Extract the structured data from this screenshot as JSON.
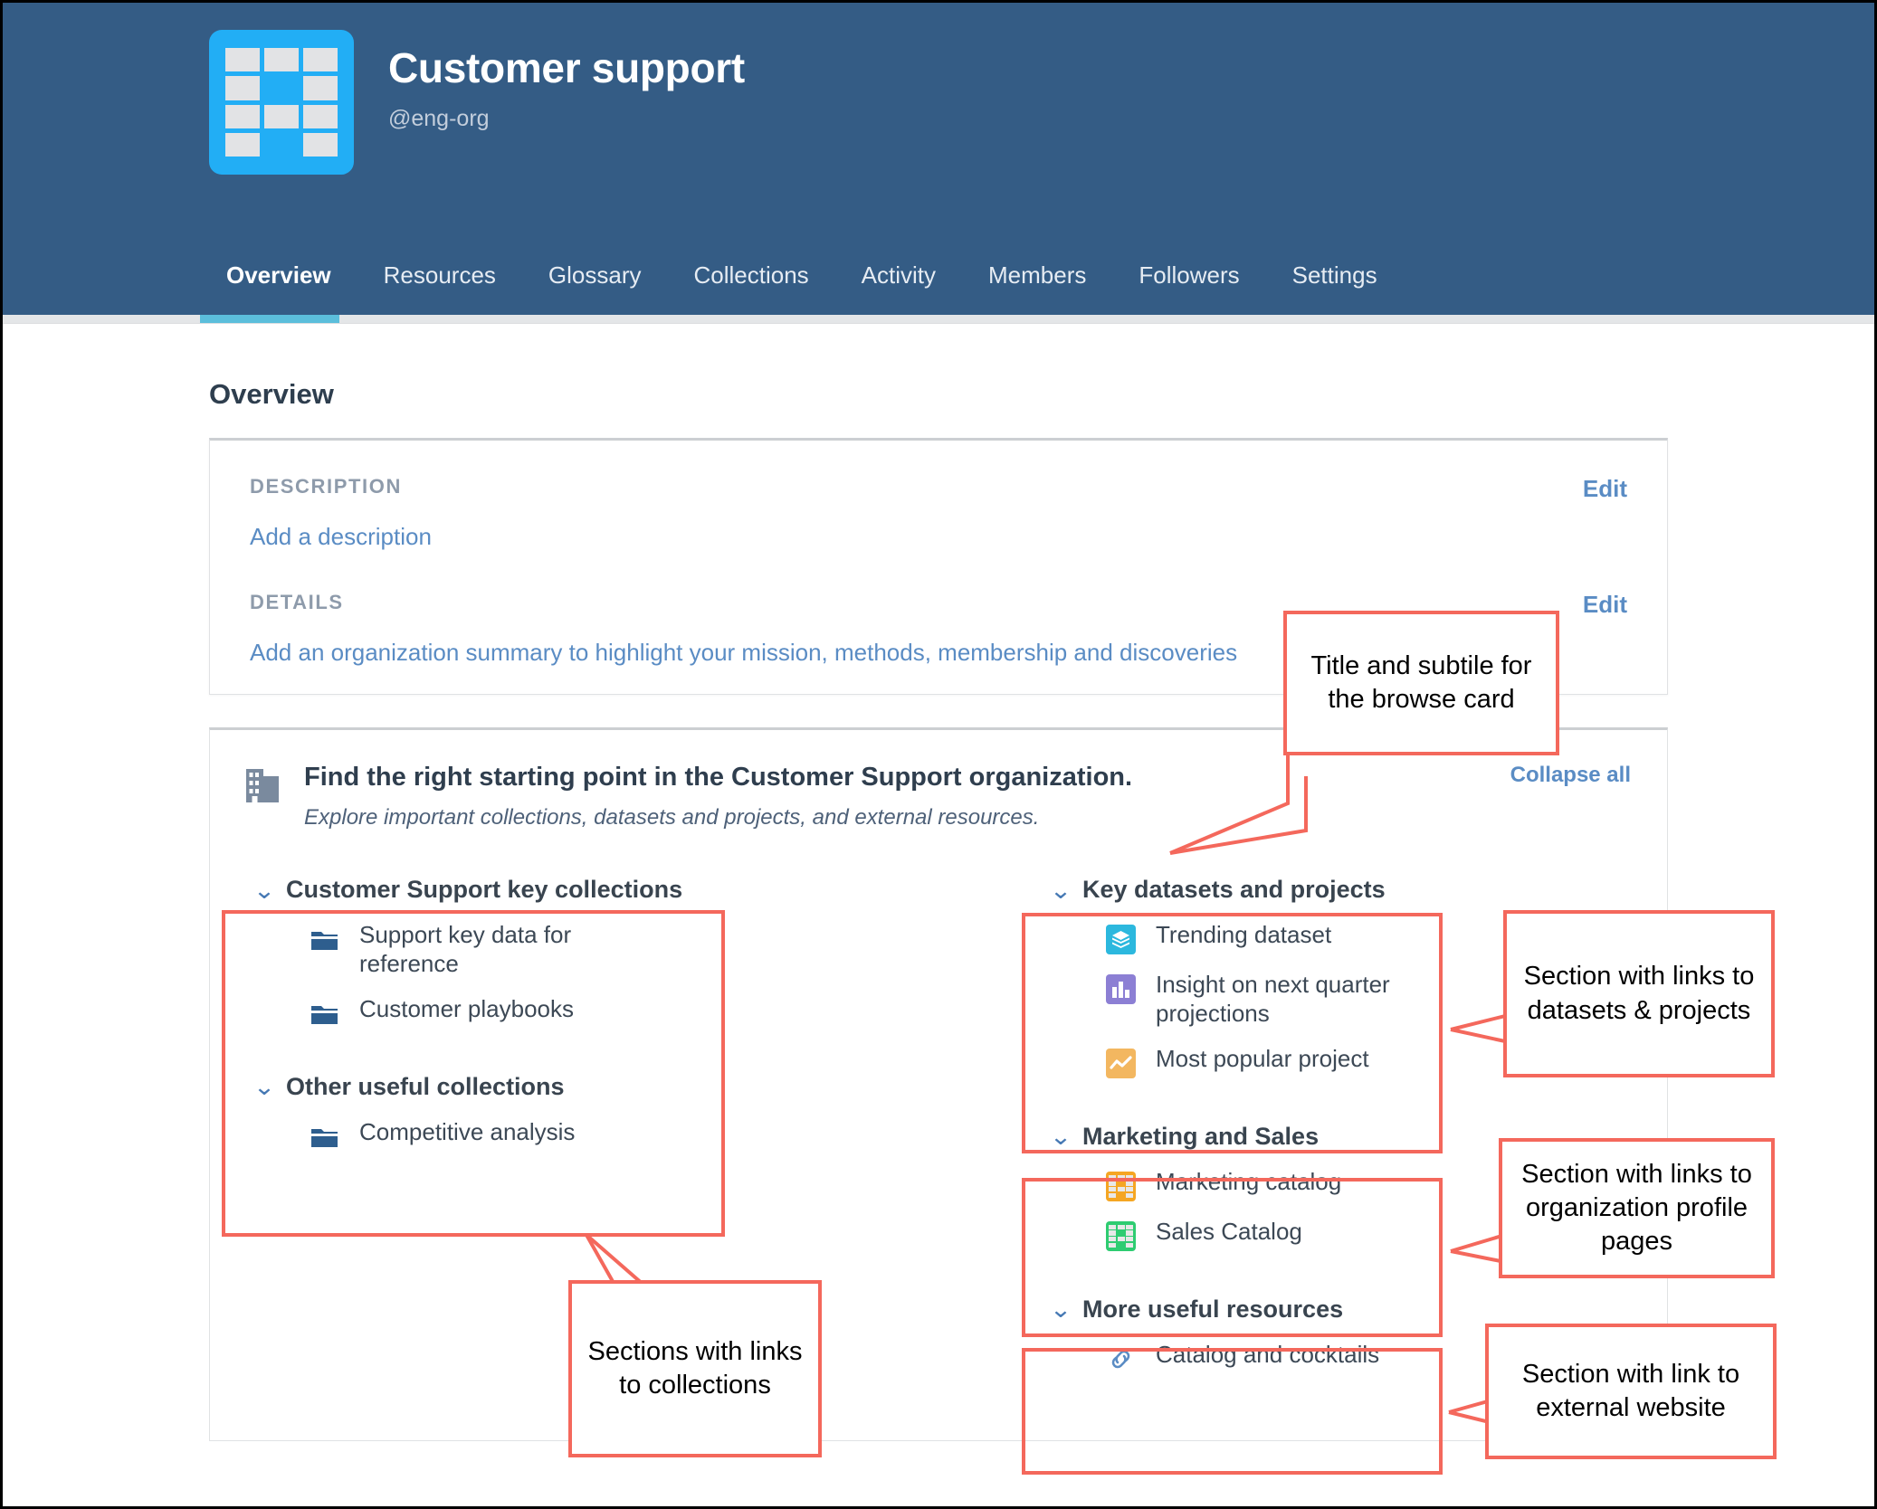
{
  "header": {
    "org_title": "Customer support",
    "org_handle": "@eng-org",
    "logo_icon": "org-grid-logo",
    "tabs": [
      {
        "label": "Overview",
        "active": true
      },
      {
        "label": "Resources",
        "active": false
      },
      {
        "label": "Glossary",
        "active": false
      },
      {
        "label": "Collections",
        "active": false
      },
      {
        "label": "Activity",
        "active": false
      },
      {
        "label": "Members",
        "active": false
      },
      {
        "label": "Followers",
        "active": false
      },
      {
        "label": "Settings",
        "active": false
      }
    ]
  },
  "main": {
    "page_title": "Overview",
    "description": {
      "label": "DESCRIPTION",
      "placeholder_link": "Add a description",
      "edit_label": "Edit"
    },
    "details": {
      "label": "DETAILS",
      "placeholder_link": "Add an organization summary to highlight your mission, methods, membership and discoveries",
      "edit_label": "Edit"
    },
    "browse": {
      "icon": "building-icon",
      "title": "Find the right starting point in the Customer Support organization.",
      "subtitle": "Explore important collections, datasets and projects, and external resources.",
      "collapse_all": "Collapse all",
      "left_sections": [
        {
          "name": "Customer Support key collections",
          "chevron": "chevron-down-icon",
          "items": [
            {
              "label": "Support key data for reference",
              "icon": "folder-icon",
              "color": "#2E5E8E"
            },
            {
              "label": "Customer playbooks",
              "icon": "folder-icon",
              "color": "#2E5E8E"
            }
          ]
        },
        {
          "name": "Other useful collections",
          "chevron": "chevron-down-icon",
          "items": [
            {
              "label": "Competitive analysis",
              "icon": "folder-icon",
              "color": "#2E5E8E"
            }
          ]
        }
      ],
      "right_sections": [
        {
          "name": "Key datasets and projects",
          "chevron": "chevron-down-icon",
          "items": [
            {
              "label": "Trending dataset",
              "icon": "dataset-layers-icon",
              "color": "#2CB8DE"
            },
            {
              "label": "Insight on next quarter projections",
              "icon": "insight-barchart-icon",
              "color": "#8C7FD4"
            },
            {
              "label": "Most popular project",
              "icon": "project-linechart-icon",
              "color": "#F3B760"
            }
          ]
        },
        {
          "name": "Marketing and Sales",
          "chevron": "chevron-down-icon",
          "items": [
            {
              "label": "Marketing catalog",
              "icon": "org-profile-icon",
              "color": "#F5A623"
            },
            {
              "label": "Sales Catalog",
              "icon": "org-profile-icon",
              "color": "#2ECC71"
            }
          ]
        },
        {
          "name": "More useful resources",
          "chevron": "chevron-down-icon",
          "items": [
            {
              "label": "Catalog and cocktails",
              "icon": "link-chain-icon",
              "color": "#5A8CC4"
            }
          ]
        }
      ]
    }
  },
  "annotations": [
    {
      "id": "a1",
      "text": "Title and subtile for the browse card"
    },
    {
      "id": "a2",
      "text": "Section with links to datasets & projects"
    },
    {
      "id": "a3",
      "text": "Section with links to organization profile pages"
    },
    {
      "id": "a4",
      "text": "Section with link to external website"
    },
    {
      "id": "a5",
      "text": "Sections with links to collections"
    }
  ],
  "colors": {
    "header_bg": "#345C85",
    "logo_blue": "#22AEF5",
    "accent_underline": "#5BBEDB",
    "link_blue": "#5A8CC4",
    "annotation_red": "#F4685C"
  }
}
